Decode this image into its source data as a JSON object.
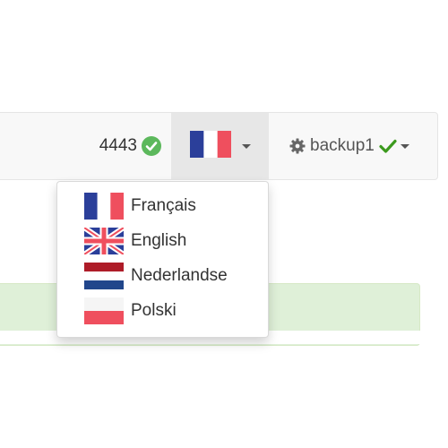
{
  "navbar": {
    "count": "4443",
    "count_icon": "check-circle-icon",
    "language_toggle_flag": "fr",
    "backup": {
      "label": "backup1",
      "left_icon": "gear-icon",
      "status_icon": "checkmark-icon"
    }
  },
  "language_menu": {
    "items": [
      {
        "label": "Français",
        "flag": "fr"
      },
      {
        "label": "English",
        "flag": "gb"
      },
      {
        "label": "Nederlandse",
        "flag": "nl"
      },
      {
        "label": "Polski",
        "flag": "pl"
      }
    ]
  },
  "colors": {
    "navbar_bg": "#f8f8f8",
    "active_toggle_bg": "#e7e7e7",
    "success_green": "#5cb85c",
    "check_green": "#3c9a1e",
    "alert_bg": "#dff0d8"
  }
}
